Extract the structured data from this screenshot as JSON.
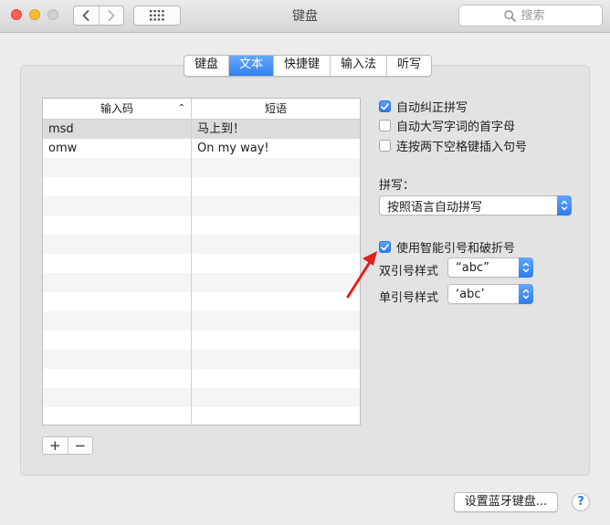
{
  "window": {
    "title": "键盘"
  },
  "search": {
    "placeholder": "搜索"
  },
  "tabs": [
    {
      "label": "键盘",
      "active": false
    },
    {
      "label": "文本",
      "active": true
    },
    {
      "label": "快捷键",
      "active": false
    },
    {
      "label": "输入法",
      "active": false
    },
    {
      "label": "听写",
      "active": false
    }
  ],
  "table": {
    "columns": [
      "输入码",
      "短语"
    ],
    "rows": [
      {
        "code": "msd",
        "phrase": "马上到！",
        "selected": true
      },
      {
        "code": "omw",
        "phrase": "On my way!",
        "selected": false
      }
    ]
  },
  "list_controls": {
    "add": "+",
    "remove": "−"
  },
  "options": {
    "auto_correct": {
      "label": "自动纠正拼写",
      "checked": true
    },
    "auto_capitalize": {
      "label": "自动大写字词的首字母",
      "checked": false
    },
    "double_space_period": {
      "label": "连按两下空格键插入句号",
      "checked": false
    },
    "spelling_label": "拼写：",
    "spelling_value": "按照语言自动拼写",
    "smart_quotes": {
      "label": "使用智能引号和破折号",
      "checked": true
    },
    "double_quote_label": "双引号样式",
    "double_quote_value": "“abc”",
    "single_quote_label": "单引号样式",
    "single_quote_value": "‘abc’"
  },
  "footer": {
    "bluetooth_button": "设置蓝牙键盘...",
    "help": "?"
  },
  "colors": {
    "accent": "#2f80f1",
    "annotation_arrow": "#e0201e"
  }
}
